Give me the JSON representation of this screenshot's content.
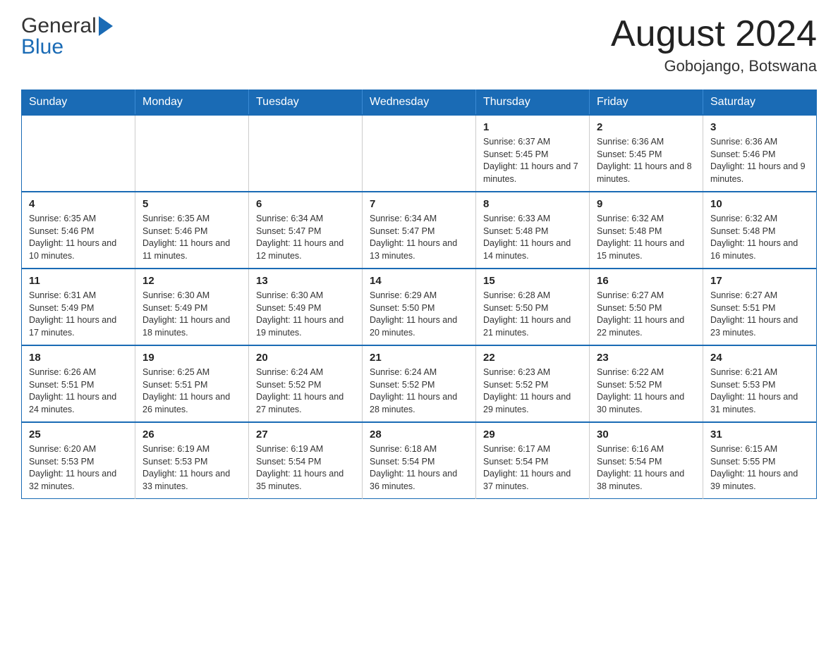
{
  "header": {
    "logo_general": "General",
    "logo_blue": "Blue",
    "month_year": "August 2024",
    "location": "Gobojango, Botswana"
  },
  "days_of_week": [
    "Sunday",
    "Monday",
    "Tuesday",
    "Wednesday",
    "Thursday",
    "Friday",
    "Saturday"
  ],
  "weeks": [
    [
      {
        "day": "",
        "info": ""
      },
      {
        "day": "",
        "info": ""
      },
      {
        "day": "",
        "info": ""
      },
      {
        "day": "",
        "info": ""
      },
      {
        "day": "1",
        "info": "Sunrise: 6:37 AM\nSunset: 5:45 PM\nDaylight: 11 hours and 7 minutes."
      },
      {
        "day": "2",
        "info": "Sunrise: 6:36 AM\nSunset: 5:45 PM\nDaylight: 11 hours and 8 minutes."
      },
      {
        "day": "3",
        "info": "Sunrise: 6:36 AM\nSunset: 5:46 PM\nDaylight: 11 hours and 9 minutes."
      }
    ],
    [
      {
        "day": "4",
        "info": "Sunrise: 6:35 AM\nSunset: 5:46 PM\nDaylight: 11 hours and 10 minutes."
      },
      {
        "day": "5",
        "info": "Sunrise: 6:35 AM\nSunset: 5:46 PM\nDaylight: 11 hours and 11 minutes."
      },
      {
        "day": "6",
        "info": "Sunrise: 6:34 AM\nSunset: 5:47 PM\nDaylight: 11 hours and 12 minutes."
      },
      {
        "day": "7",
        "info": "Sunrise: 6:34 AM\nSunset: 5:47 PM\nDaylight: 11 hours and 13 minutes."
      },
      {
        "day": "8",
        "info": "Sunrise: 6:33 AM\nSunset: 5:48 PM\nDaylight: 11 hours and 14 minutes."
      },
      {
        "day": "9",
        "info": "Sunrise: 6:32 AM\nSunset: 5:48 PM\nDaylight: 11 hours and 15 minutes."
      },
      {
        "day": "10",
        "info": "Sunrise: 6:32 AM\nSunset: 5:48 PM\nDaylight: 11 hours and 16 minutes."
      }
    ],
    [
      {
        "day": "11",
        "info": "Sunrise: 6:31 AM\nSunset: 5:49 PM\nDaylight: 11 hours and 17 minutes."
      },
      {
        "day": "12",
        "info": "Sunrise: 6:30 AM\nSunset: 5:49 PM\nDaylight: 11 hours and 18 minutes."
      },
      {
        "day": "13",
        "info": "Sunrise: 6:30 AM\nSunset: 5:49 PM\nDaylight: 11 hours and 19 minutes."
      },
      {
        "day": "14",
        "info": "Sunrise: 6:29 AM\nSunset: 5:50 PM\nDaylight: 11 hours and 20 minutes."
      },
      {
        "day": "15",
        "info": "Sunrise: 6:28 AM\nSunset: 5:50 PM\nDaylight: 11 hours and 21 minutes."
      },
      {
        "day": "16",
        "info": "Sunrise: 6:27 AM\nSunset: 5:50 PM\nDaylight: 11 hours and 22 minutes."
      },
      {
        "day": "17",
        "info": "Sunrise: 6:27 AM\nSunset: 5:51 PM\nDaylight: 11 hours and 23 minutes."
      }
    ],
    [
      {
        "day": "18",
        "info": "Sunrise: 6:26 AM\nSunset: 5:51 PM\nDaylight: 11 hours and 24 minutes."
      },
      {
        "day": "19",
        "info": "Sunrise: 6:25 AM\nSunset: 5:51 PM\nDaylight: 11 hours and 26 minutes."
      },
      {
        "day": "20",
        "info": "Sunrise: 6:24 AM\nSunset: 5:52 PM\nDaylight: 11 hours and 27 minutes."
      },
      {
        "day": "21",
        "info": "Sunrise: 6:24 AM\nSunset: 5:52 PM\nDaylight: 11 hours and 28 minutes."
      },
      {
        "day": "22",
        "info": "Sunrise: 6:23 AM\nSunset: 5:52 PM\nDaylight: 11 hours and 29 minutes."
      },
      {
        "day": "23",
        "info": "Sunrise: 6:22 AM\nSunset: 5:52 PM\nDaylight: 11 hours and 30 minutes."
      },
      {
        "day": "24",
        "info": "Sunrise: 6:21 AM\nSunset: 5:53 PM\nDaylight: 11 hours and 31 minutes."
      }
    ],
    [
      {
        "day": "25",
        "info": "Sunrise: 6:20 AM\nSunset: 5:53 PM\nDaylight: 11 hours and 32 minutes."
      },
      {
        "day": "26",
        "info": "Sunrise: 6:19 AM\nSunset: 5:53 PM\nDaylight: 11 hours and 33 minutes."
      },
      {
        "day": "27",
        "info": "Sunrise: 6:19 AM\nSunset: 5:54 PM\nDaylight: 11 hours and 35 minutes."
      },
      {
        "day": "28",
        "info": "Sunrise: 6:18 AM\nSunset: 5:54 PM\nDaylight: 11 hours and 36 minutes."
      },
      {
        "day": "29",
        "info": "Sunrise: 6:17 AM\nSunset: 5:54 PM\nDaylight: 11 hours and 37 minutes."
      },
      {
        "day": "30",
        "info": "Sunrise: 6:16 AM\nSunset: 5:54 PM\nDaylight: 11 hours and 38 minutes."
      },
      {
        "day": "31",
        "info": "Sunrise: 6:15 AM\nSunset: 5:55 PM\nDaylight: 11 hours and 39 minutes."
      }
    ]
  ]
}
